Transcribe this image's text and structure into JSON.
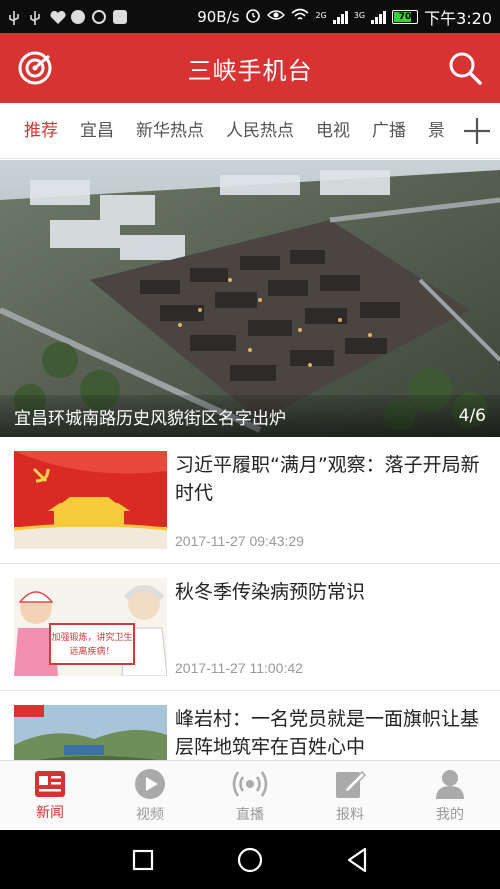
{
  "status_bar": {
    "speed": "90B/s",
    "network_a": "2G",
    "network_b": "3G",
    "battery": "70",
    "time": "下午3:20"
  },
  "header": {
    "title": "三峡手机台",
    "left_icon": "live-radar-icon",
    "right_icon": "search-icon",
    "brand_color": "#d83333"
  },
  "tabs": [
    {
      "label": "推荐",
      "active": true
    },
    {
      "label": "宜昌",
      "active": false
    },
    {
      "label": "新华热点",
      "active": false
    },
    {
      "label": "人民热点",
      "active": false
    },
    {
      "label": "电视",
      "active": false
    },
    {
      "label": "广播",
      "active": false
    },
    {
      "label": "景",
      "active": false
    }
  ],
  "banner": {
    "caption": "宜昌环城南路历史风貌街区名字出炉",
    "index": "4/6"
  },
  "news": [
    {
      "title": "习近平履职“满月”观察：落子开局新时代",
      "time": "2017-11-27 09:43:29"
    },
    {
      "title": "秋冬季传染病预防常识",
      "time": "2017-11-27 11:00:42"
    },
    {
      "title": "峰岩村：一名党员就是一面旗帜让基层阵地筑牢在百姓心中",
      "time": ""
    }
  ],
  "thumb_text": {
    "poster_line1": "加强锻炼，讲究卫生",
    "poster_line2": "远离疾病！"
  },
  "bottom_nav": [
    {
      "label": "新闻",
      "icon": "news-icon",
      "active": true
    },
    {
      "label": "视频",
      "icon": "video-play-icon",
      "active": false
    },
    {
      "label": "直播",
      "icon": "broadcast-icon",
      "active": false
    },
    {
      "label": "报料",
      "icon": "edit-report-icon",
      "active": false
    },
    {
      "label": "我的",
      "icon": "user-icon",
      "active": false
    }
  ]
}
